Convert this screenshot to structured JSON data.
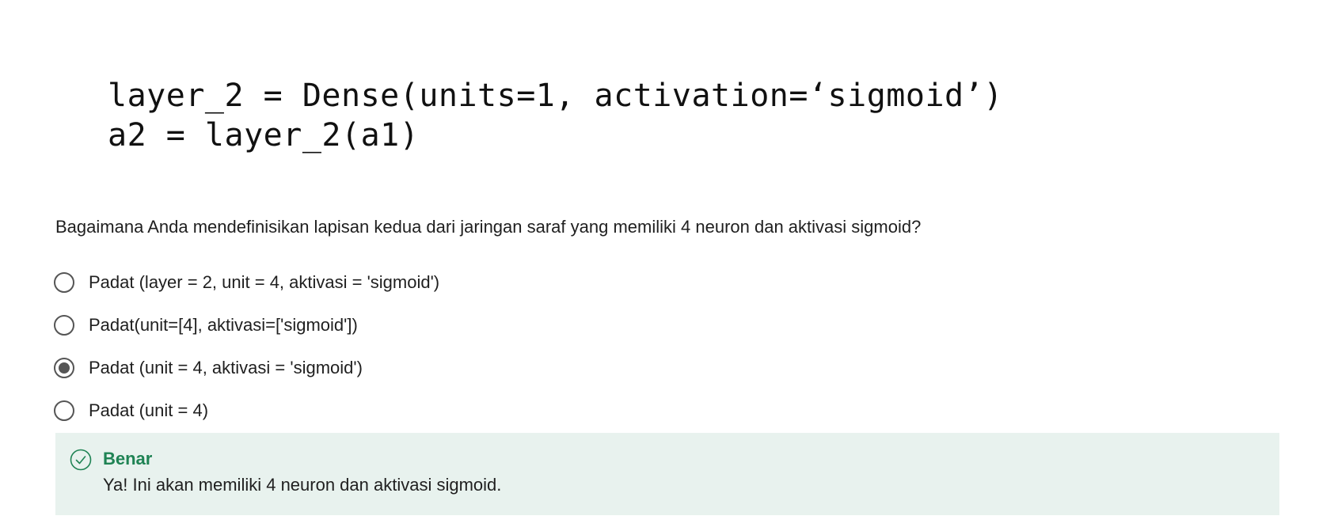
{
  "code_block": {
    "line_1": "layer_2 = Dense(units=1, activation=‘sigmoid’)",
    "line_2": "a2 = layer_2(a1)"
  },
  "question": {
    "text": "Bagaimana Anda mendefinisikan lapisan kedua dari jaringan saraf yang memiliki 4 neuron dan aktivasi sigmoid?",
    "options": [
      {
        "label": "Padat (layer = 2, unit = 4, aktivasi = 'sigmoid')",
        "selected": false
      },
      {
        "label": "Padat(unit=[4], aktivasi=['sigmoid'])",
        "selected": false
      },
      {
        "label": "Padat (unit = 4, aktivasi = 'sigmoid')",
        "selected": true
      },
      {
        "label": "Padat (unit = 4)",
        "selected": false
      }
    ]
  },
  "feedback": {
    "title": "Benar",
    "message": "Ya! Ini akan memiliki 4 neuron dan aktivasi sigmoid.",
    "icon": "check-circle-icon",
    "accent_color": "#1f8354",
    "background_color": "#e8f2ee"
  }
}
